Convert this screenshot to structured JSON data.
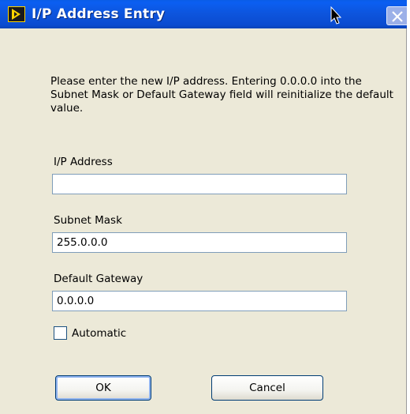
{
  "window": {
    "title": "I/P Address Entry"
  },
  "message": "Please enter the new I/P address.  Entering 0.0.0.0 into the Subnet Mask or Default Gateway field will reinitialize the default value.",
  "fields": {
    "ip_address": {
      "label": "I/P Address",
      "value": ""
    },
    "subnet_mask": {
      "label": "Subnet Mask",
      "value": "255.0.0.0"
    },
    "default_gateway": {
      "label": "Default Gateway",
      "value": "0.0.0.0"
    }
  },
  "automatic": {
    "label": "Automatic",
    "checked": false
  },
  "buttons": {
    "ok": "OK",
    "cancel": "Cancel"
  },
  "colors": {
    "titlebar": "#0b5ff2",
    "dialog_bg": "#ece9d8",
    "field_border": "#7f9db9"
  },
  "icons": {
    "app": "labview-run-icon",
    "close": "close-icon",
    "cursor": "mouse-pointer-icon"
  }
}
